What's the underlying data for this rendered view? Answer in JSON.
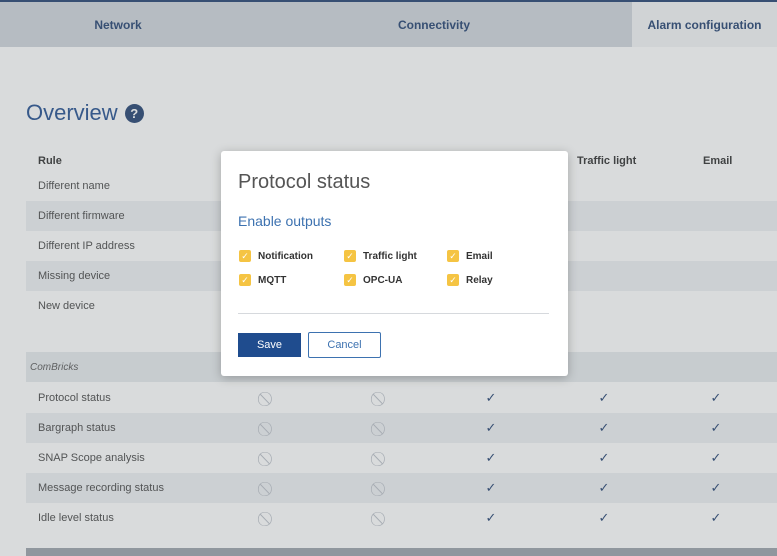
{
  "tabs": [
    {
      "label": "Network"
    },
    {
      "label": "Connectivity"
    },
    {
      "label": "Alarm configuration"
    }
  ],
  "overview": {
    "title": "Overview",
    "help_glyph": "?"
  },
  "columns": {
    "rule": "Rule",
    "traffic_light": "Traffic light",
    "email": "Email"
  },
  "rules_top": [
    "Different name",
    "Different firmware",
    "Different IP address",
    "Missing device",
    "New device"
  ],
  "section": {
    "label": "ComBricks"
  },
  "rules_combricks": [
    {
      "label": "Protocol status"
    },
    {
      "label": "Bargraph status"
    },
    {
      "label": "SNAP Scope analysis"
    },
    {
      "label": "Message recording status"
    },
    {
      "label": "Idle level status"
    }
  ],
  "status_glyphs": {
    "blocked": "⃠",
    "ok": "✓"
  },
  "dialog": {
    "title": "Protocol status",
    "subtitle": "Enable outputs",
    "options": [
      "Notification",
      "Traffic light",
      "Email",
      "MQTT",
      "OPC-UA",
      "Relay"
    ],
    "save_label": "Save",
    "cancel_label": "Cancel"
  },
  "colors": {
    "brand": "#1f3e6e",
    "accent": "#3d72b0",
    "checkbox": "#f5c443"
  }
}
